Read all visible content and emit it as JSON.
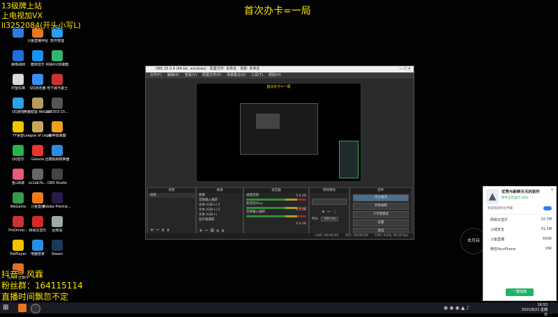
{
  "overlay": {
    "top_center": "首次办卡=一局",
    "top_left_lines": [
      "13级牌上站",
      "上电视加VX",
      "ll3252084(开头小写L)"
    ],
    "bottom_left_lines": [
      "抖音：风霖",
      "粉丝群：164115114",
      "直播时间飘忽不定"
    ]
  },
  "desktop_icons": [
    {
      "label": "",
      "color": "#2a7de1"
    },
    {
      "label": "斗鱼直播伴侣",
      "color": "#e87722"
    },
    {
      "label": "软件管理",
      "color": "#2a9df4"
    },
    {
      "label": "暴雨战网",
      "color": "#1e6fd9"
    },
    {
      "label": "酷狗音乐",
      "color": "#1f8ff0"
    },
    {
      "label": "网易UU加速器",
      "color": "#37b36b"
    },
    {
      "label": "中望先锋",
      "color": "#d9d9d9"
    },
    {
      "label": "QQ浏览器",
      "color": "#3b8cf3"
    },
    {
      "label": "地下城与勇士",
      "color": "#c9332e"
    },
    {
      "label": "QQ游戏",
      "color": "#2da1e6"
    },
    {
      "label": "英雄联盟 WeGame版",
      "color": "#b89b5e"
    },
    {
      "label": "222303-15...",
      "color": "#555"
    },
    {
      "label": "YY语音",
      "color": "#f2c500"
    },
    {
      "label": "League of Legends",
      "color": "#c8a85a"
    },
    {
      "label": "雷神加速器",
      "color": "#f0a020"
    },
    {
      "label": "QQ音乐",
      "color": "#29b34a"
    },
    {
      "label": "Garena",
      "color": "#e33"
    },
    {
      "label": "迅捷视频转换器",
      "color": "#2d8ce0"
    },
    {
      "label": "金山K歌",
      "color": "#e85b7a"
    },
    {
      "label": "sc1ab7b...",
      "color": "#666"
    },
    {
      "label": "OBS Studio",
      "color": "#444"
    },
    {
      "label": "WeGame",
      "color": "#3a9a4a"
    },
    {
      "label": "斗鱼直播",
      "color": "#f07a1a"
    },
    {
      "label": "Adobe Premie...",
      "color": "#2a1a4a"
    },
    {
      "label": "ProDriver...",
      "color": "#c33"
    },
    {
      "label": "网易云音乐",
      "color": "#d42a2a"
    },
    {
      "label": "回收站",
      "color": "#9aa"
    },
    {
      "label": "PotPlayer",
      "color": "#f2c200"
    },
    {
      "label": "电脑管家",
      "color": "#2a8ee6"
    },
    {
      "label": "Steam",
      "color": "#1b3a5a"
    },
    {
      "label": "火绒安全软件",
      "color": "#e0702a"
    }
  ],
  "obs": {
    "title": "OBS 25.0.8 (64-bit, windows) - 配置文件: 未命名 - 场景: 未命名",
    "menu": [
      "文件(F)",
      "编辑(E)",
      "查看(V)",
      "配置文件(P)",
      "场景集合(S)",
      "工具(T)",
      "帮助(H)"
    ],
    "preview_caption": "首次办卡=一局",
    "docks": {
      "scenes": {
        "title": "场景",
        "items": [
          "场景"
        ]
      },
      "sources": {
        "title": "来源",
        "items": [
          "图像",
          "音频输入捕获",
          "文本 (GDI+) 3",
          "文本 (GDI+) 2",
          "文本 (GDI+)",
          "显示器捕获"
        ]
      },
      "mixer": {
        "title": "混音器",
        "channels": [
          {
            "name": "桌面音频",
            "level": "0.0 dB"
          },
          {
            "name": "麦克风/Aux",
            "level": "0.0 dB"
          },
          {
            "name": "音频输入捕获",
            "level": "0.0 dB"
          }
        ]
      },
      "transitions": {
        "title": "转场特效",
        "duration_label": "时长",
        "duration_value": "300 ms"
      },
      "controls": {
        "title": "控件",
        "buttons": [
          "停止推流",
          "开始录制",
          "工作室模式",
          "设置",
          "退出"
        ]
      }
    },
    "status": {
      "live": "LIVE: 00:00:00",
      "rec": "REC: 00:00:00",
      "cpu": "CPU: 4.6%, 60.00 fps"
    }
  },
  "popup": {
    "title": "优秀与新鲜天天的软件",
    "subtitle": "软件正在运行 10%",
    "toggle_label": "智能限速优化传输",
    "items": [
      {
        "name": "网易云音乐",
        "value": "32.7M"
      },
      {
        "name": "火绒安全",
        "value": "31.1M"
      },
      {
        "name": "斗鱼直播",
        "value": "600K"
      },
      {
        "name": "微信YourPhone",
        "value": "16K"
      }
    ],
    "button": "一键加速"
  },
  "clock_widget": "本月启",
  "taskbar": {
    "time": "16:53",
    "date": "2021/8/22 星期日"
  }
}
